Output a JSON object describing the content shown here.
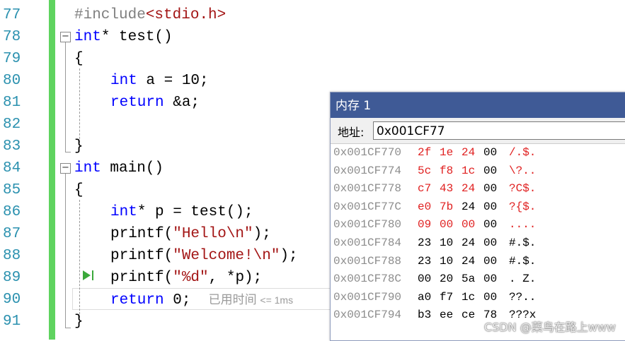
{
  "editor": {
    "line_numbers": [
      "77",
      "78",
      "79",
      "80",
      "81",
      "82",
      "83",
      "84",
      "85",
      "86",
      "87",
      "88",
      "89",
      "90",
      "91"
    ],
    "lines": {
      "l77": [
        "#include",
        "<stdio.h>"
      ],
      "l78": [
        "int",
        "* test()"
      ],
      "l79": "{",
      "l80": [
        "int",
        " a = 10;"
      ],
      "l81": [
        "return",
        " &a;"
      ],
      "l83": "}",
      "l84": [
        "int",
        " main()"
      ],
      "l85": "{",
      "l86": [
        "int",
        "* p = test();"
      ],
      "l87": [
        "printf(",
        "\"Hello\\n\"",
        ");"
      ],
      "l88": [
        "printf(",
        "\"Welcome!\\n\"",
        ");"
      ],
      "l89": [
        "printf(",
        "\"%d\"",
        ", *p);"
      ],
      "l90": [
        "return",
        " 0;"
      ],
      "l91": "}"
    },
    "elapsed_hint": "已用时间",
    "elapsed_value": "<= 1ms",
    "collapse_glyph": "−"
  },
  "memory_window": {
    "title": "内存 1",
    "address_label": "地址:",
    "address_value": "0x001CF77",
    "rows": [
      {
        "addr": "0x001CF770",
        "bytes": [
          "2f",
          "1e",
          "24",
          "00"
        ],
        "ascii": "/.$.",
        "changed": [
          true,
          true,
          true,
          false
        ]
      },
      {
        "addr": "0x001CF774",
        "bytes": [
          "5c",
          "f8",
          "1c",
          "00"
        ],
        "ascii": "\\?..",
        "changed": [
          true,
          true,
          true,
          false
        ]
      },
      {
        "addr": "0x001CF778",
        "bytes": [
          "c7",
          "43",
          "24",
          "00"
        ],
        "ascii": "?C$.",
        "changed": [
          true,
          true,
          true,
          false
        ]
      },
      {
        "addr": "0x001CF77C",
        "bytes": [
          "e0",
          "7b",
          "24",
          "00"
        ],
        "ascii": "?{$.",
        "changed": [
          true,
          true,
          false,
          false
        ]
      },
      {
        "addr": "0x001CF780",
        "bytes": [
          "09",
          "00",
          "00",
          "00"
        ],
        "ascii": "....",
        "changed": [
          true,
          true,
          true,
          false
        ]
      },
      {
        "addr": "0x001CF784",
        "bytes": [
          "23",
          "10",
          "24",
          "00"
        ],
        "ascii": "#.$.",
        "changed": [
          false,
          false,
          false,
          false
        ]
      },
      {
        "addr": "0x001CF788",
        "bytes": [
          "23",
          "10",
          "24",
          "00"
        ],
        "ascii": "#.$.",
        "changed": [
          false,
          false,
          false,
          false
        ]
      },
      {
        "addr": "0x001CF78C",
        "bytes": [
          "00",
          "20",
          "5a",
          "00"
        ],
        "ascii": ". Z.",
        "changed": [
          false,
          false,
          false,
          false
        ]
      },
      {
        "addr": "0x001CF790",
        "bytes": [
          "a0",
          "f7",
          "1c",
          "00"
        ],
        "ascii": "??..",
        "changed": [
          false,
          false,
          false,
          false
        ]
      },
      {
        "addr": "0x001CF794",
        "bytes": [
          "b3",
          "ee",
          "ce",
          "78"
        ],
        "ascii": "???x",
        "changed": [
          false,
          false,
          false,
          false
        ]
      }
    ]
  },
  "watermark": "CSDN @菜鸟在路上www",
  "colors": {
    "keyword": "#0000ff",
    "string": "#a31515",
    "line_number": "#2b91af",
    "changed_byte": "#e02020",
    "title_bar": "#3f5a96",
    "change_bar": "#5fd35f"
  }
}
